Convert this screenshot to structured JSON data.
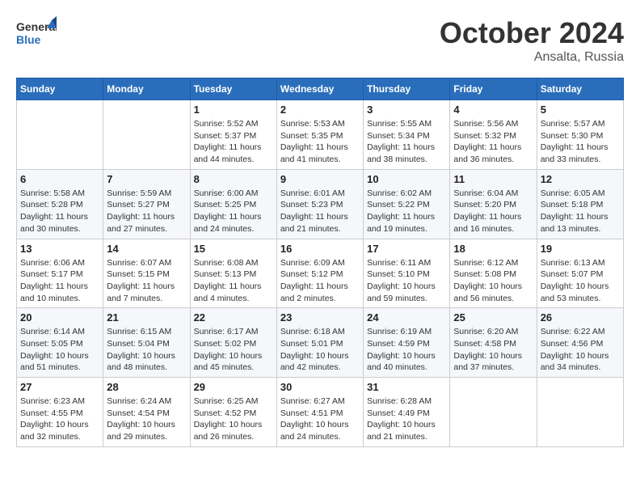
{
  "header": {
    "logo_text_general": "General",
    "logo_text_blue": "Blue",
    "month": "October 2024",
    "location": "Ansalta, Russia"
  },
  "days_of_week": [
    "Sunday",
    "Monday",
    "Tuesday",
    "Wednesday",
    "Thursday",
    "Friday",
    "Saturday"
  ],
  "weeks": [
    [
      {
        "day": "",
        "info": ""
      },
      {
        "day": "",
        "info": ""
      },
      {
        "day": "1",
        "sunrise": "5:52 AM",
        "sunset": "5:37 PM",
        "daylight": "11 hours and 44 minutes."
      },
      {
        "day": "2",
        "sunrise": "5:53 AM",
        "sunset": "5:35 PM",
        "daylight": "11 hours and 41 minutes."
      },
      {
        "day": "3",
        "sunrise": "5:55 AM",
        "sunset": "5:34 PM",
        "daylight": "11 hours and 38 minutes."
      },
      {
        "day": "4",
        "sunrise": "5:56 AM",
        "sunset": "5:32 PM",
        "daylight": "11 hours and 36 minutes."
      },
      {
        "day": "5",
        "sunrise": "5:57 AM",
        "sunset": "5:30 PM",
        "daylight": "11 hours and 33 minutes."
      }
    ],
    [
      {
        "day": "6",
        "sunrise": "5:58 AM",
        "sunset": "5:28 PM",
        "daylight": "11 hours and 30 minutes."
      },
      {
        "day": "7",
        "sunrise": "5:59 AM",
        "sunset": "5:27 PM",
        "daylight": "11 hours and 27 minutes."
      },
      {
        "day": "8",
        "sunrise": "6:00 AM",
        "sunset": "5:25 PM",
        "daylight": "11 hours and 24 minutes."
      },
      {
        "day": "9",
        "sunrise": "6:01 AM",
        "sunset": "5:23 PM",
        "daylight": "11 hours and 21 minutes."
      },
      {
        "day": "10",
        "sunrise": "6:02 AM",
        "sunset": "5:22 PM",
        "daylight": "11 hours and 19 minutes."
      },
      {
        "day": "11",
        "sunrise": "6:04 AM",
        "sunset": "5:20 PM",
        "daylight": "11 hours and 16 minutes."
      },
      {
        "day": "12",
        "sunrise": "6:05 AM",
        "sunset": "5:18 PM",
        "daylight": "11 hours and 13 minutes."
      }
    ],
    [
      {
        "day": "13",
        "sunrise": "6:06 AM",
        "sunset": "5:17 PM",
        "daylight": "11 hours and 10 minutes."
      },
      {
        "day": "14",
        "sunrise": "6:07 AM",
        "sunset": "5:15 PM",
        "daylight": "11 hours and 7 minutes."
      },
      {
        "day": "15",
        "sunrise": "6:08 AM",
        "sunset": "5:13 PM",
        "daylight": "11 hours and 4 minutes."
      },
      {
        "day": "16",
        "sunrise": "6:09 AM",
        "sunset": "5:12 PM",
        "daylight": "11 hours and 2 minutes."
      },
      {
        "day": "17",
        "sunrise": "6:11 AM",
        "sunset": "5:10 PM",
        "daylight": "10 hours and 59 minutes."
      },
      {
        "day": "18",
        "sunrise": "6:12 AM",
        "sunset": "5:08 PM",
        "daylight": "10 hours and 56 minutes."
      },
      {
        "day": "19",
        "sunrise": "6:13 AM",
        "sunset": "5:07 PM",
        "daylight": "10 hours and 53 minutes."
      }
    ],
    [
      {
        "day": "20",
        "sunrise": "6:14 AM",
        "sunset": "5:05 PM",
        "daylight": "10 hours and 51 minutes."
      },
      {
        "day": "21",
        "sunrise": "6:15 AM",
        "sunset": "5:04 PM",
        "daylight": "10 hours and 48 minutes."
      },
      {
        "day": "22",
        "sunrise": "6:17 AM",
        "sunset": "5:02 PM",
        "daylight": "10 hours and 45 minutes."
      },
      {
        "day": "23",
        "sunrise": "6:18 AM",
        "sunset": "5:01 PM",
        "daylight": "10 hours and 42 minutes."
      },
      {
        "day": "24",
        "sunrise": "6:19 AM",
        "sunset": "4:59 PM",
        "daylight": "10 hours and 40 minutes."
      },
      {
        "day": "25",
        "sunrise": "6:20 AM",
        "sunset": "4:58 PM",
        "daylight": "10 hours and 37 minutes."
      },
      {
        "day": "26",
        "sunrise": "6:22 AM",
        "sunset": "4:56 PM",
        "daylight": "10 hours and 34 minutes."
      }
    ],
    [
      {
        "day": "27",
        "sunrise": "6:23 AM",
        "sunset": "4:55 PM",
        "daylight": "10 hours and 32 minutes."
      },
      {
        "day": "28",
        "sunrise": "6:24 AM",
        "sunset": "4:54 PM",
        "daylight": "10 hours and 29 minutes."
      },
      {
        "day": "29",
        "sunrise": "6:25 AM",
        "sunset": "4:52 PM",
        "daylight": "10 hours and 26 minutes."
      },
      {
        "day": "30",
        "sunrise": "6:27 AM",
        "sunset": "4:51 PM",
        "daylight": "10 hours and 24 minutes."
      },
      {
        "day": "31",
        "sunrise": "6:28 AM",
        "sunset": "4:49 PM",
        "daylight": "10 hours and 21 minutes."
      },
      {
        "day": "",
        "info": ""
      },
      {
        "day": "",
        "info": ""
      }
    ]
  ],
  "labels": {
    "sunrise": "Sunrise:",
    "sunset": "Sunset:",
    "daylight": "Daylight hours"
  }
}
